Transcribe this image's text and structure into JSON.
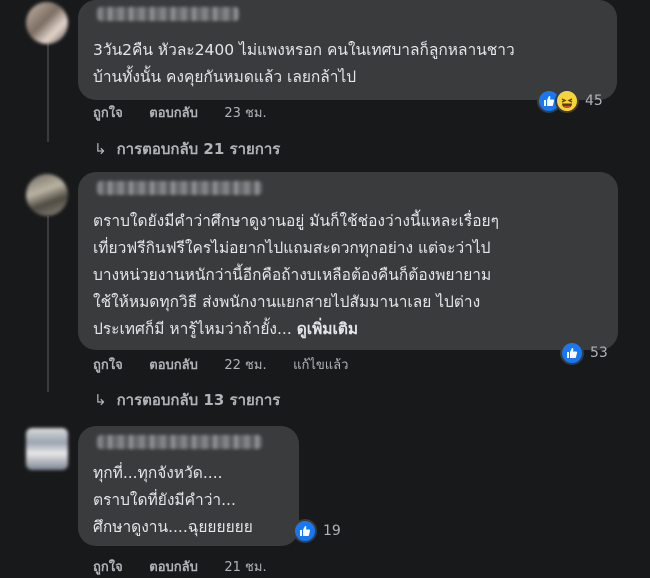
{
  "comments": [
    {
      "lines": [
        "3วัน2คืน หัวละ2400 ไม่แพงหรอก คนในเทศบาลก็ลูกหลานชาว",
        "บ้านทั้งนั้น คงคุยกันหมดแล้ว เลยกล้าไป"
      ],
      "actions": {
        "like": "ถูกใจ",
        "reply": "ตอบกลับ",
        "time": "23 ชม."
      },
      "reaction_count": "45",
      "replies": "การตอบกลับ 21 รายการ"
    },
    {
      "lines": [
        "ตราบใดยังมีคำว่าศึกษาดูงานอยู่ มันก็ใช้ช่องว่างนี้แหละเรื่อยๆ",
        "เที่ยวฟรีกินฟรีใครไม่อยากไปแถมสะดวกทุกอย่าง แต่จะว่าไป",
        "บางหน่วยงานหนักว่านี้อีกคือถ้างบเหลือต้องคืนก็ต้องพยายาม",
        "ใช้ให้หมดทุกวิธี ส่งพนักงานแยกสายไปสัมมานาเลย ไปต่าง",
        "ประเทศก็มี หารู้ไหมว่าถ้ายั้ง..."
      ],
      "see_more": "ดูเพิ่มเติม",
      "actions": {
        "like": "ถูกใจ",
        "reply": "ตอบกลับ",
        "time": "22 ชม.",
        "edited": "แก้ไขแล้ว"
      },
      "reaction_count": "53",
      "replies": "การตอบกลับ 13 รายการ"
    },
    {
      "lines": [
        "ทุกที่...ทุกจังหวัด....",
        "ตราบใดที่ยังมีคำว่า...",
        "ศึกษาดูงาน....ฉุยยยยยย"
      ],
      "actions": {
        "like": "ถูกใจ",
        "reply": "ตอบกลับ",
        "time": "21 ชม."
      },
      "reaction_count": "19"
    }
  ],
  "colors": {
    "background": "#18191a",
    "bubble": "#3a3b3c",
    "text": "#e4e6eb",
    "secondary": "#b0b3b8",
    "like_blue": "#1877f2",
    "haha_yellow": "#f7d33a"
  }
}
